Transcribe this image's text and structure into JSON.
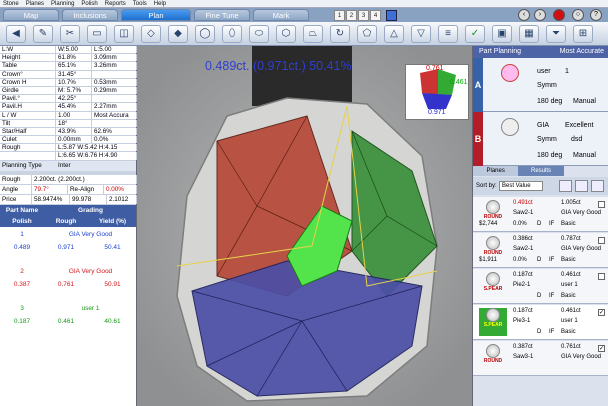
{
  "menu": [
    "Stone",
    "Planes",
    "Planning",
    "Polish",
    "Reports",
    "Tools",
    "Help"
  ],
  "tabs": [
    "Map",
    "Inclusions",
    "Plan",
    "Fine Tune",
    "Mark"
  ],
  "active_tab": "Plan",
  "num_buttons": [
    "1",
    "2",
    "3",
    "4"
  ],
  "props": [
    [
      "L:W",
      "W:5.00",
      "L:5.00"
    ],
    [
      "Height",
      "61.8%",
      "3.09mm"
    ],
    [
      "Table",
      "65.1%",
      "3.26mm"
    ],
    [
      "Crown°",
      "31.45°",
      ""
    ],
    [
      "Crown H",
      "10.7%",
      "0.53mm"
    ],
    [
      "Girdle",
      "M: 5.7%",
      "0.29mm"
    ],
    [
      "Pavil.°",
      "42.25°",
      ""
    ],
    [
      "Pavil.H",
      "45.4%",
      "2.27mm"
    ],
    [
      "L / W",
      "1.00",
      "Most Accura"
    ],
    [
      "Tilt",
      "18°",
      ""
    ],
    [
      "Star/Half",
      "43.9%",
      "62.6%"
    ],
    [
      "Culet",
      "0.00mm",
      "0.0%"
    ],
    [
      "Rough",
      "L:5.87 W:5.42 H:4.15",
      ""
    ],
    [
      "",
      "L:6.65 W:6.76 H:4.90",
      ""
    ]
  ],
  "planning_type": {
    "label": "Planning Type",
    "value": "Inter"
  },
  "summary": {
    "rough_label": "Rough",
    "rough_value": "2.200ct. (2.200ct.)",
    "angle_label": "Angle",
    "angle_value": "79.7°",
    "realign_label": "Re-Align",
    "realign_value": "0.00%",
    "price_label": "Price",
    "price_value": "58.9474%",
    "price_v2": "99.978",
    "price_v3": "2.1012"
  },
  "grading_header": {
    "part_name": "Part Name",
    "grading": "Grading",
    "polish": "Polish",
    "rough": "Rough",
    "yield": "Yield (%)"
  },
  "parts": [
    {
      "num": "1",
      "grade": "GIA Very Good",
      "polish": "0.489",
      "rough": "0.971",
      "yield": "50.41",
      "color": "#1a3fcf"
    },
    {
      "num": "2",
      "grade": "GIA Very Good",
      "polish": "0.387",
      "rough": "0.761",
      "yield": "50.91",
      "color": "#d01818"
    },
    {
      "num": "3",
      "grade": "user 1",
      "polish": "0.187",
      "rough": "0.461",
      "yield": "40.61",
      "color": "#159a15"
    }
  ],
  "overlay_text": "0.489ct. (0.971ct.) 50.41%",
  "mini": {
    "red": "0.761",
    "green": "0.461",
    "blue": "0.971"
  },
  "right": {
    "title": "Part Planning",
    "mode": "Most Accurate",
    "planA": {
      "letter": "A",
      "grade": "user",
      "val": "1",
      "symm": "Symm",
      "deg": "180 deg",
      "method": "Manual"
    },
    "planB": {
      "letter": "B",
      "grade": "GIA",
      "val": "Excellent",
      "symm": "Symm",
      "deg": "dsd",
      "deg2": "180 deg",
      "method": "Manual"
    },
    "subtabs": [
      "Planes",
      "Results"
    ],
    "sortby": "Sort by:",
    "sortval": "Best Value",
    "rows": [
      {
        "shape": "ROUND",
        "a": "0.491ct",
        "b": "1.005ct",
        "c": "Saw2-1",
        "d": "GIA Very Good",
        "e": "$2,744",
        "f": "0.0%",
        "g": "D",
        "h": "IF",
        "i": "Basic"
      },
      {
        "shape": "ROUND",
        "a": "0.386ct",
        "b": "0.787ct",
        "c": "Saw2-1",
        "d": "GIA Very Good",
        "e": "$1,911",
        "f": "0.0%",
        "g": "D",
        "h": "IF",
        "i": "Basic"
      },
      {
        "shape": "S.PEAR",
        "a": "0.187ct",
        "b": "0.461ct",
        "c": "Pie2-1",
        "d": "user 1",
        "e": "",
        "f": "",
        "g": "D",
        "h": "IF",
        "i": "Basic"
      },
      {
        "shape": "S.PEAR",
        "a": "0.187ct",
        "b": "0.461ct",
        "c": "Pie3-1",
        "d": "user 1",
        "e": "",
        "f": "",
        "g": "D",
        "h": "IF",
        "i": "Basic"
      },
      {
        "shape": "ROUND",
        "a": "0.387ct",
        "b": "0.761ct",
        "c": "Saw3-1",
        "d": "GIA Very Good",
        "e": "",
        "f": "",
        "g": "",
        "h": "",
        "i": ""
      }
    ]
  }
}
